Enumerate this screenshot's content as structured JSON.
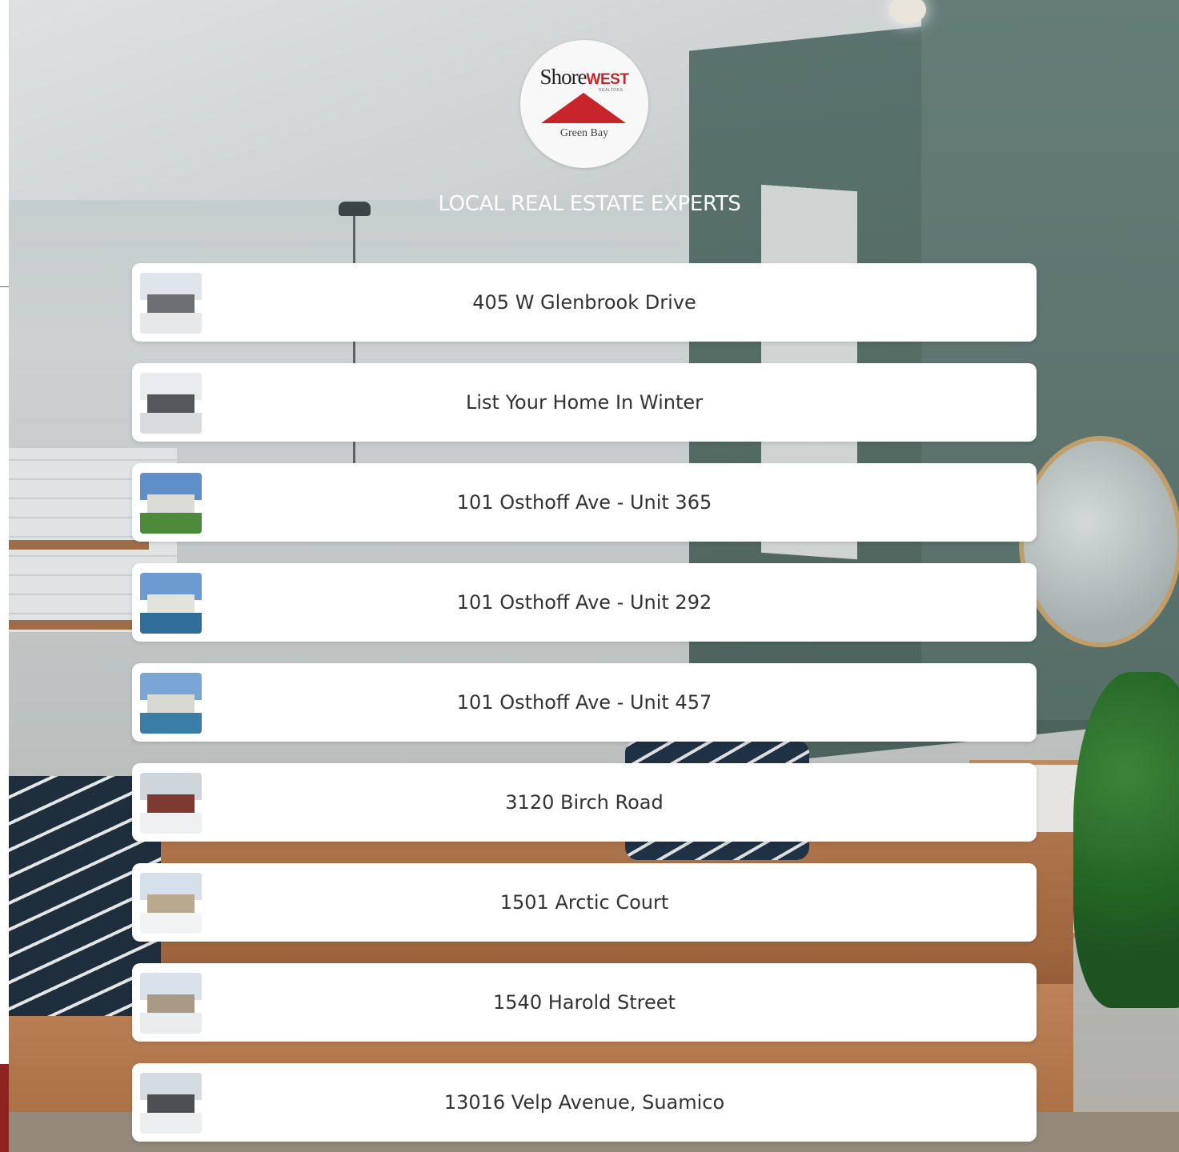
{
  "brand": {
    "logo_word_1": "Shore",
    "logo_word_2": "WEST",
    "logo_sub": "REALTORS",
    "logo_city": "Green Bay",
    "accent_color": "#c8242b"
  },
  "tagline": "LOCAL REAL ESTATE EXPERTS",
  "links": [
    {
      "label": "405 W Glenbrook Drive",
      "thumb": {
        "sky": "#dfe5ea",
        "house": "#6b6f72",
        "ground": "#e6e8ea"
      }
    },
    {
      "label": "List Your Home In Winter",
      "thumb": {
        "sky": "#e8ecee",
        "house": "#55585a",
        "ground": "#d9dcde"
      }
    },
    {
      "label": "101 Osthoff Ave - Unit 365",
      "thumb": {
        "sky": "#5f8fc8",
        "house": "#dcdcd6",
        "ground": "#4d8a3a"
      }
    },
    {
      "label": "101 Osthoff Ave - Unit 292",
      "thumb": {
        "sky": "#6b9bd0",
        "house": "#e3e3dd",
        "ground": "#2f6e9a"
      }
    },
    {
      "label": "101 Osthoff Ave - Unit 457",
      "thumb": {
        "sky": "#7aa6d6",
        "house": "#d8d8d2",
        "ground": "#3a7ea8"
      }
    },
    {
      "label": "3120 Birch Road",
      "thumb": {
        "sky": "#cfd6db",
        "house": "#7c3a30",
        "ground": "#eef0f1"
      }
    },
    {
      "label": "1501 Arctic Court",
      "thumb": {
        "sky": "#d6e0ea",
        "house": "#b8a98f",
        "ground": "#f2f3f4"
      }
    },
    {
      "label": "1540 Harold Street",
      "thumb": {
        "sky": "#d9e2ea",
        "house": "#a89a84",
        "ground": "#e9ebec"
      }
    },
    {
      "label": "13016 Velp Avenue, Suamico",
      "thumb": {
        "sky": "#d4dbe1",
        "house": "#4d5052",
        "ground": "#eceeef"
      }
    }
  ]
}
